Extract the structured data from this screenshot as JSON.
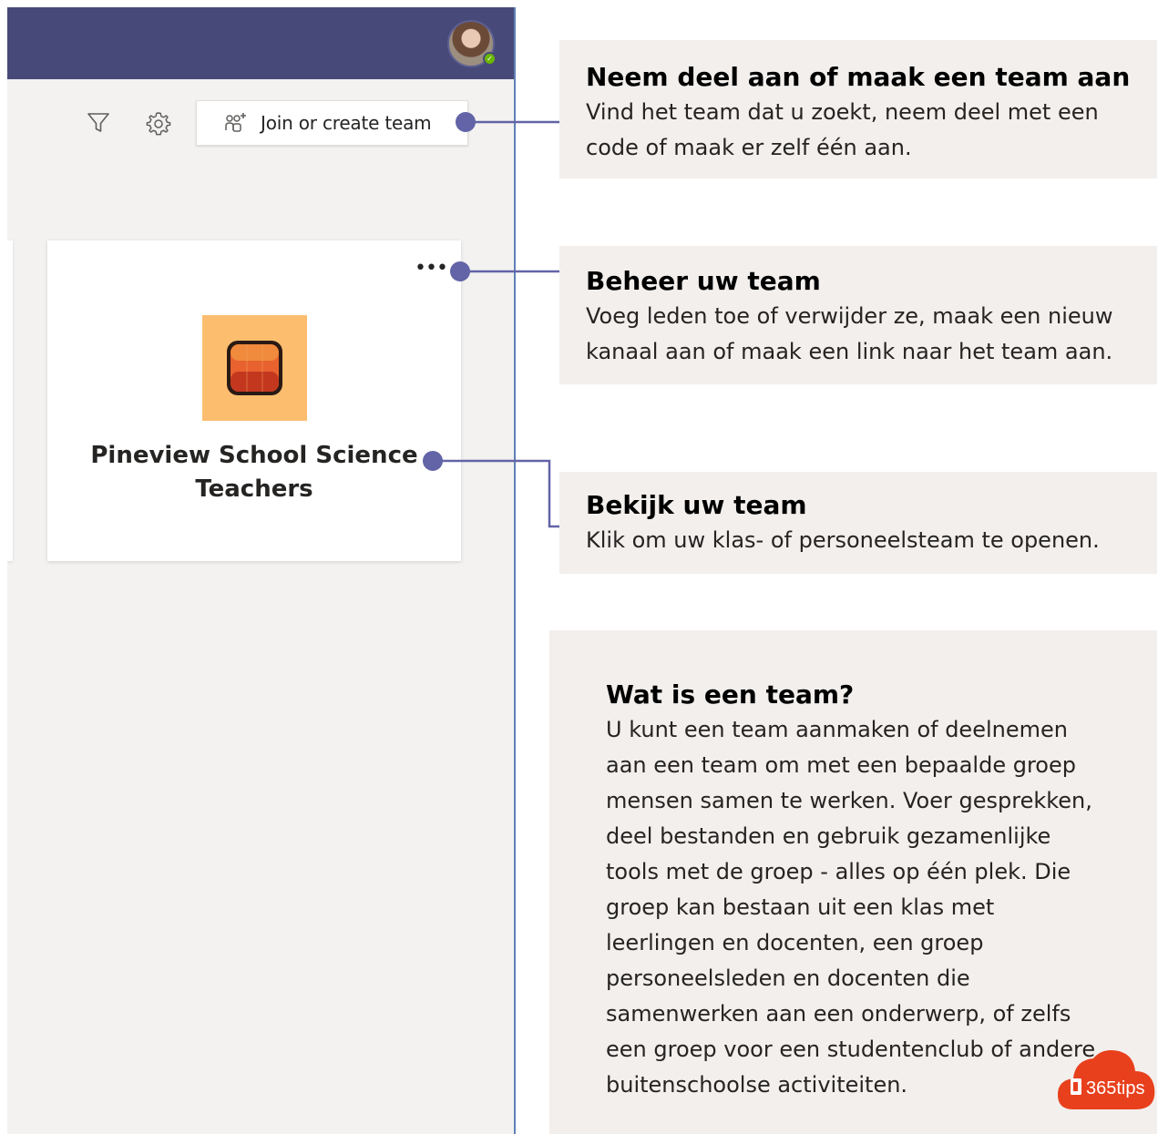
{
  "teams_app": {
    "toolbar": {
      "filter_icon": "filter-icon",
      "settings_icon": "gear-icon",
      "join_button_label": "Join or create team",
      "join_button_icon": "people-add-icon"
    },
    "team_card": {
      "more_options_label": "•••",
      "name": "Pineview School Science Teachers",
      "avatar_color": "#fcbe6e",
      "logo_colors": [
        "#e8622f",
        "#c4371f",
        "#f08a3c"
      ]
    },
    "header_color": "#474a78",
    "presence_status": "available"
  },
  "callouts": [
    {
      "title": "Neem deel aan of maak een team aan",
      "text": "Vind het team dat u zoekt, neem deel met een code of maak er zelf één aan."
    },
    {
      "title": "Beheer uw team",
      "text": "Voeg leden toe of verwijder ze, maak een nieuw kanaal aan of maak een link naar het team aan."
    },
    {
      "title": "Bekijk uw team",
      "text": "Klik om uw klas- of personeelsteam te openen."
    }
  ],
  "info_box": {
    "title": "Wat is een team?",
    "text": "U kunt een team aanmaken of deelnemen aan een team om met een bepaalde groep mensen samen te werken. Voer gesprekken, deel bestanden en gebruik gezamenlijke tools met de groep - alles op één plek. Die groep kan bestaan uit een klas met leerlingen en docenten, een groep personeelsleden en docenten die samenwerken aan een onderwerp, of zelfs een groep voor een studentenclub of andere buitenschoolse activiteiten."
  },
  "brand": {
    "logo_text": "365tips",
    "color": "#e8401c"
  },
  "connector_color": "#6264a7"
}
